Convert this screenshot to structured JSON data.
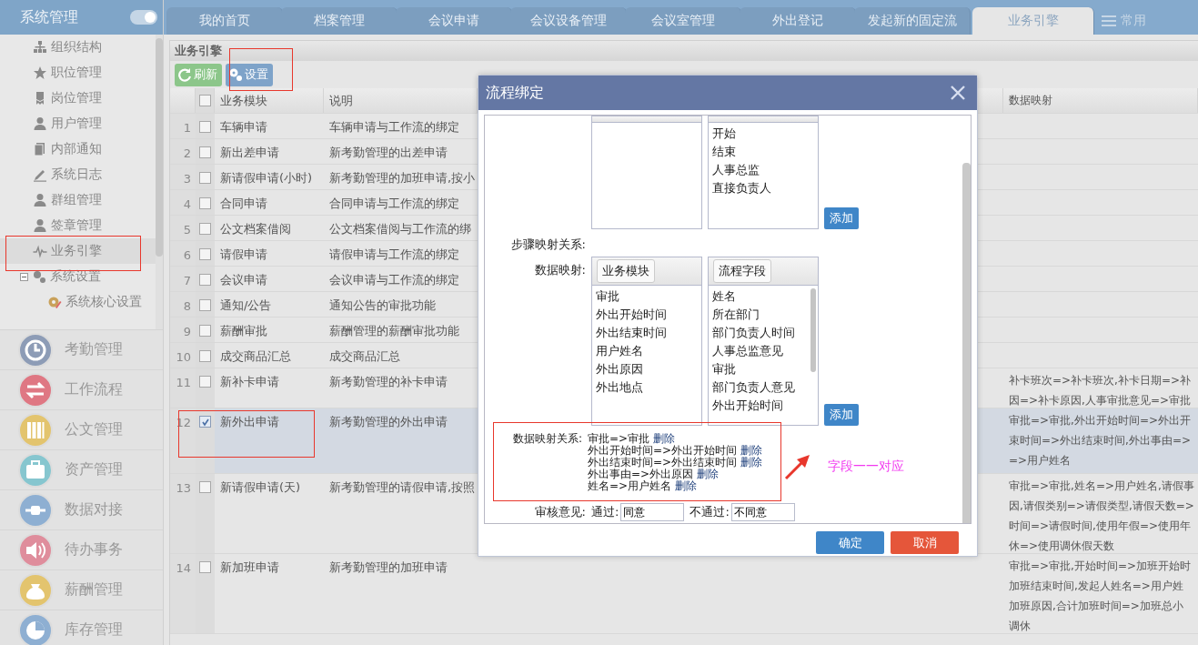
{
  "sidebar": {
    "title": "系统管理",
    "toggle_on": true,
    "tree": [
      {
        "label": "组织结构",
        "selected": false
      },
      {
        "label": "职位管理",
        "selected": false
      },
      {
        "label": "岗位管理",
        "selected": false
      },
      {
        "label": "用户管理",
        "selected": false
      },
      {
        "label": "内部通知",
        "selected": false
      },
      {
        "label": "系统日志",
        "selected": false
      },
      {
        "label": "群组管理",
        "selected": false
      },
      {
        "label": "签章管理",
        "selected": false
      },
      {
        "label": "业务引擎",
        "selected": true
      },
      {
        "label": "系统设置",
        "selected": false,
        "expanded": true,
        "children": [
          {
            "label": "系统核心设置",
            "selected": false
          }
        ]
      }
    ],
    "modules": [
      {
        "label": "考勤管理"
      },
      {
        "label": "工作流程"
      },
      {
        "label": "公文管理"
      },
      {
        "label": "资产管理"
      },
      {
        "label": "数据对接"
      },
      {
        "label": "待办事务"
      },
      {
        "label": "薪酬管理"
      },
      {
        "label": "库存管理"
      }
    ]
  },
  "tabs": [
    {
      "label": "我的首页",
      "selected": false
    },
    {
      "label": "档案管理",
      "selected": false
    },
    {
      "label": "会议申请",
      "selected": false
    },
    {
      "label": "会议设备管理",
      "selected": false
    },
    {
      "label": "会议室管理",
      "selected": false
    },
    {
      "label": "外出登记",
      "selected": false
    },
    {
      "label": "发起新的固定流",
      "selected": false
    },
    {
      "label": "业务引擎",
      "selected": true
    }
  ],
  "tabs_menu": "常用",
  "panel": {
    "title": "业务引擎",
    "buttons": [
      {
        "label": "刷新",
        "kind": "refresh"
      },
      {
        "label": "设置",
        "kind": "settings"
      }
    ]
  },
  "table": {
    "all_checked": false,
    "columns": [
      "业务模块",
      "说明",
      "数据映射"
    ],
    "rows": [
      {
        "index": "1",
        "checked": false,
        "selected": false,
        "module": "车辆申请",
        "description": "车辆申请与工作流的绑定"
      },
      {
        "index": "2",
        "checked": false,
        "selected": false,
        "module": "新出差申请",
        "description": "新考勤管理的出差申请"
      },
      {
        "index": "3",
        "checked": false,
        "selected": false,
        "module": "新请假申请(小时)",
        "description": "新考勤管理的加班申请,按小"
      },
      {
        "index": "4",
        "checked": false,
        "selected": false,
        "module": "合同申请",
        "description": "合同申请与工作流的绑定"
      },
      {
        "index": "5",
        "checked": false,
        "selected": false,
        "module": "公文档案借阅",
        "description": "公文档案借阅与工作流的绑"
      },
      {
        "index": "6",
        "checked": false,
        "selected": false,
        "module": "请假申请",
        "description": "请假申请与工作流的绑定"
      },
      {
        "index": "7",
        "checked": false,
        "selected": false,
        "module": "会议申请",
        "description": "会议申请与工作流的绑定"
      },
      {
        "index": "8",
        "checked": false,
        "selected": false,
        "module": "通知/公告",
        "description": "通知公告的审批功能"
      },
      {
        "index": "9",
        "checked": false,
        "selected": false,
        "module": "薪酬审批",
        "description": "薪酬管理的薪酬审批功能"
      },
      {
        "index": "10",
        "checked": false,
        "selected": false,
        "module": "成交商品汇总",
        "description": "成交商品汇总"
      },
      {
        "index": "11",
        "checked": false,
        "selected": false,
        "module": "新补卡申请",
        "description": "新考勤管理的补卡申请",
        "mapping": [
          "补卡班次=>补卡班次,补卡日期=>补",
          "因=>补卡原因,人事审批意见=>审批"
        ]
      },
      {
        "index": "12",
        "checked": true,
        "selected": true,
        "module": "新外出申请",
        "description": "新考勤管理的外出申请",
        "mapping": [
          "审批=>审批,外出开始时间=>外出开",
          "束时间=>外出结束时间,外出事由=>",
          "=>用户姓名"
        ]
      },
      {
        "index": "13",
        "checked": false,
        "selected": false,
        "module": "新请假申请(天)",
        "description": "新考勤管理的请假申请,按照",
        "mapping": [
          "审批=>审批,姓名=>用户姓名,请假事",
          "因,请假类别=>请假类型,请假天数=>",
          "时间=>请假时间,使用年假=>使用年",
          "休=>使用调休假天数"
        ]
      },
      {
        "index": "14",
        "checked": false,
        "selected": false,
        "module": "新加班申请",
        "description": "新考勤管理的加班申请",
        "mapping": [
          "审批=>审批,开始时间=>加班开始时",
          "加班结束时间,发起人姓名=>用户姓",
          "加班原因,合计加班时间=>加班总小",
          "调休"
        ]
      }
    ]
  },
  "dialog": {
    "title": "流程绑定",
    "step_section": {
      "right_items": [
        "开始",
        "结束",
        "人事总监",
        "直接负责人"
      ],
      "add_button": "添加",
      "relation_label": "步骤映射关系:"
    },
    "data_section": {
      "label": "数据映射:",
      "left_header": "业务模块",
      "left_items": [
        "审批",
        "外出开始时间",
        "外出结束时间",
        "用户姓名",
        "外出原因",
        "外出地点"
      ],
      "right_header": "流程字段",
      "right_items": [
        "姓名",
        "所在部门",
        "部门负责人时间",
        "人事总监意见",
        "审批",
        "部门负责人意见",
        "外出开始时间"
      ],
      "add_button": "添加"
    },
    "mapping_relations": {
      "label": "数据映射关系:",
      "items": [
        {
          "text": "审批=>审批",
          "action": "删除"
        },
        {
          "text": "外出开始时间=>外出开始时间",
          "action": "删除"
        },
        {
          "text": "外出结束时间=>外出结束时间",
          "action": "删除"
        },
        {
          "text": "外出事由=>外出原因",
          "action": "删除"
        },
        {
          "text": "姓名=>用户姓名",
          "action": "删除"
        }
      ]
    },
    "review": {
      "label": "审核意见:",
      "pass_label": "通过:",
      "pass_value": "同意",
      "fail_label": "不通过:",
      "fail_value": "不同意"
    },
    "buttons": [
      {
        "label": "确定",
        "kind": "primary"
      },
      {
        "label": "取消",
        "kind": "danger"
      }
    ]
  },
  "annotation": {
    "note": "字段一一对应"
  }
}
